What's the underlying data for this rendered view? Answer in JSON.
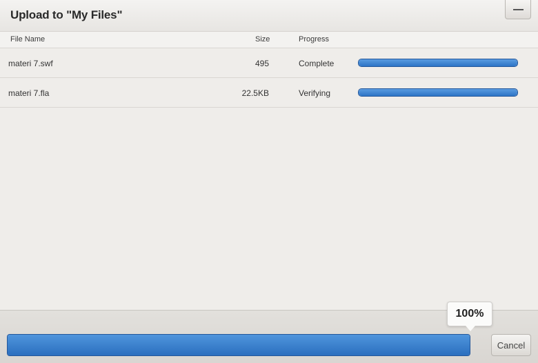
{
  "dialog": {
    "title": "Upload to \"My Files\"",
    "minimize_icon": "minimize-icon"
  },
  "table": {
    "columns": [
      "File Name",
      "Size",
      "Progress"
    ],
    "rows": [
      {
        "name": "materi 7.swf",
        "size": "495",
        "status": "Complete",
        "progress": 1.0
      },
      {
        "name": "materi 7.fla",
        "size": "22.5KB",
        "status": "Verifying",
        "progress": 1.0
      }
    ]
  },
  "footer": {
    "overall_progress_label": "100%",
    "overall_progress": 1.0,
    "cancel_label": "Cancel"
  },
  "colors": {
    "progress_fill": "#2e75c6",
    "progress_border": "#24579a"
  }
}
